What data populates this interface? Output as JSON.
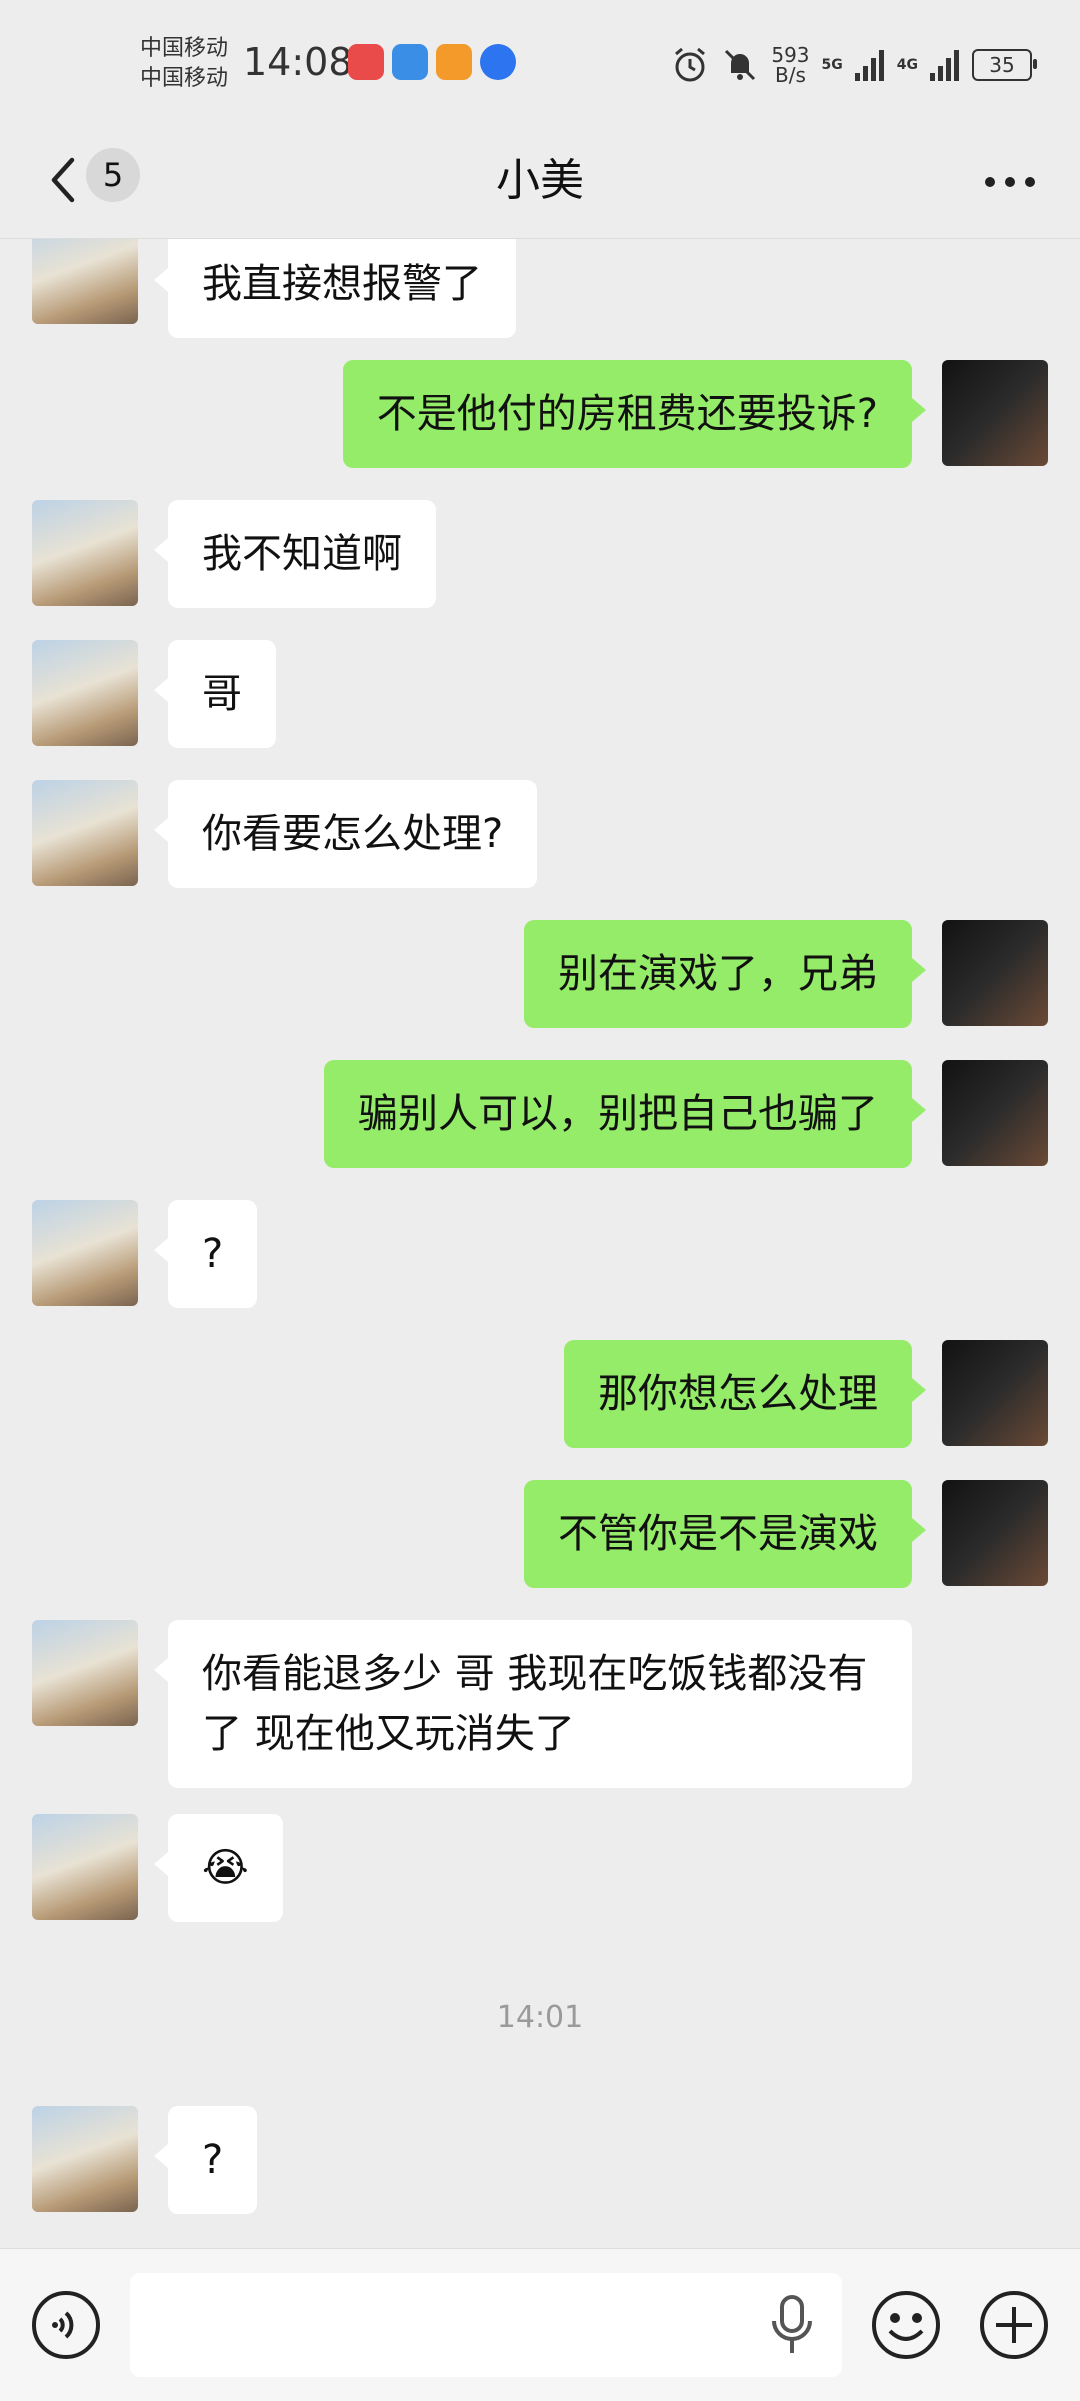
{
  "status_bar": {
    "carrier_1": "中国移动",
    "carrier_2": "中国移动",
    "time": "14:08",
    "speed_value": "593",
    "speed_unit": "B/s",
    "network_1": "5G",
    "network_2": "4G",
    "battery": "35"
  },
  "header": {
    "unread_count": "5",
    "title": "小美"
  },
  "messages": [
    {
      "side": "left",
      "text": "我直接想报警了"
    },
    {
      "side": "right",
      "text": "不是他付的房租费还要投诉?"
    },
    {
      "side": "left",
      "text": "我不知道啊"
    },
    {
      "side": "left",
      "text": "哥"
    },
    {
      "side": "left",
      "text": "你看要怎么处理?"
    },
    {
      "side": "right",
      "text": "别在演戏了，兄弟"
    },
    {
      "side": "right",
      "text": "骗别人可以，别把自己也骗了"
    },
    {
      "side": "left",
      "text": "?"
    },
    {
      "side": "right",
      "text": "那你想怎么处理"
    },
    {
      "side": "right",
      "text": "不管你是不是演戏"
    },
    {
      "side": "left",
      "text": "你看能退多少 哥 我现在吃饭钱都没有了 现在他又玩消失了"
    },
    {
      "side": "left",
      "text": "😭"
    },
    {
      "side": "left",
      "text": "?"
    }
  ],
  "timestamp": "14:01",
  "input": {
    "placeholder": ""
  },
  "colors": {
    "background": "#ededed",
    "outgoing_bubble": "#95ec69",
    "incoming_bubble": "#ffffff"
  }
}
